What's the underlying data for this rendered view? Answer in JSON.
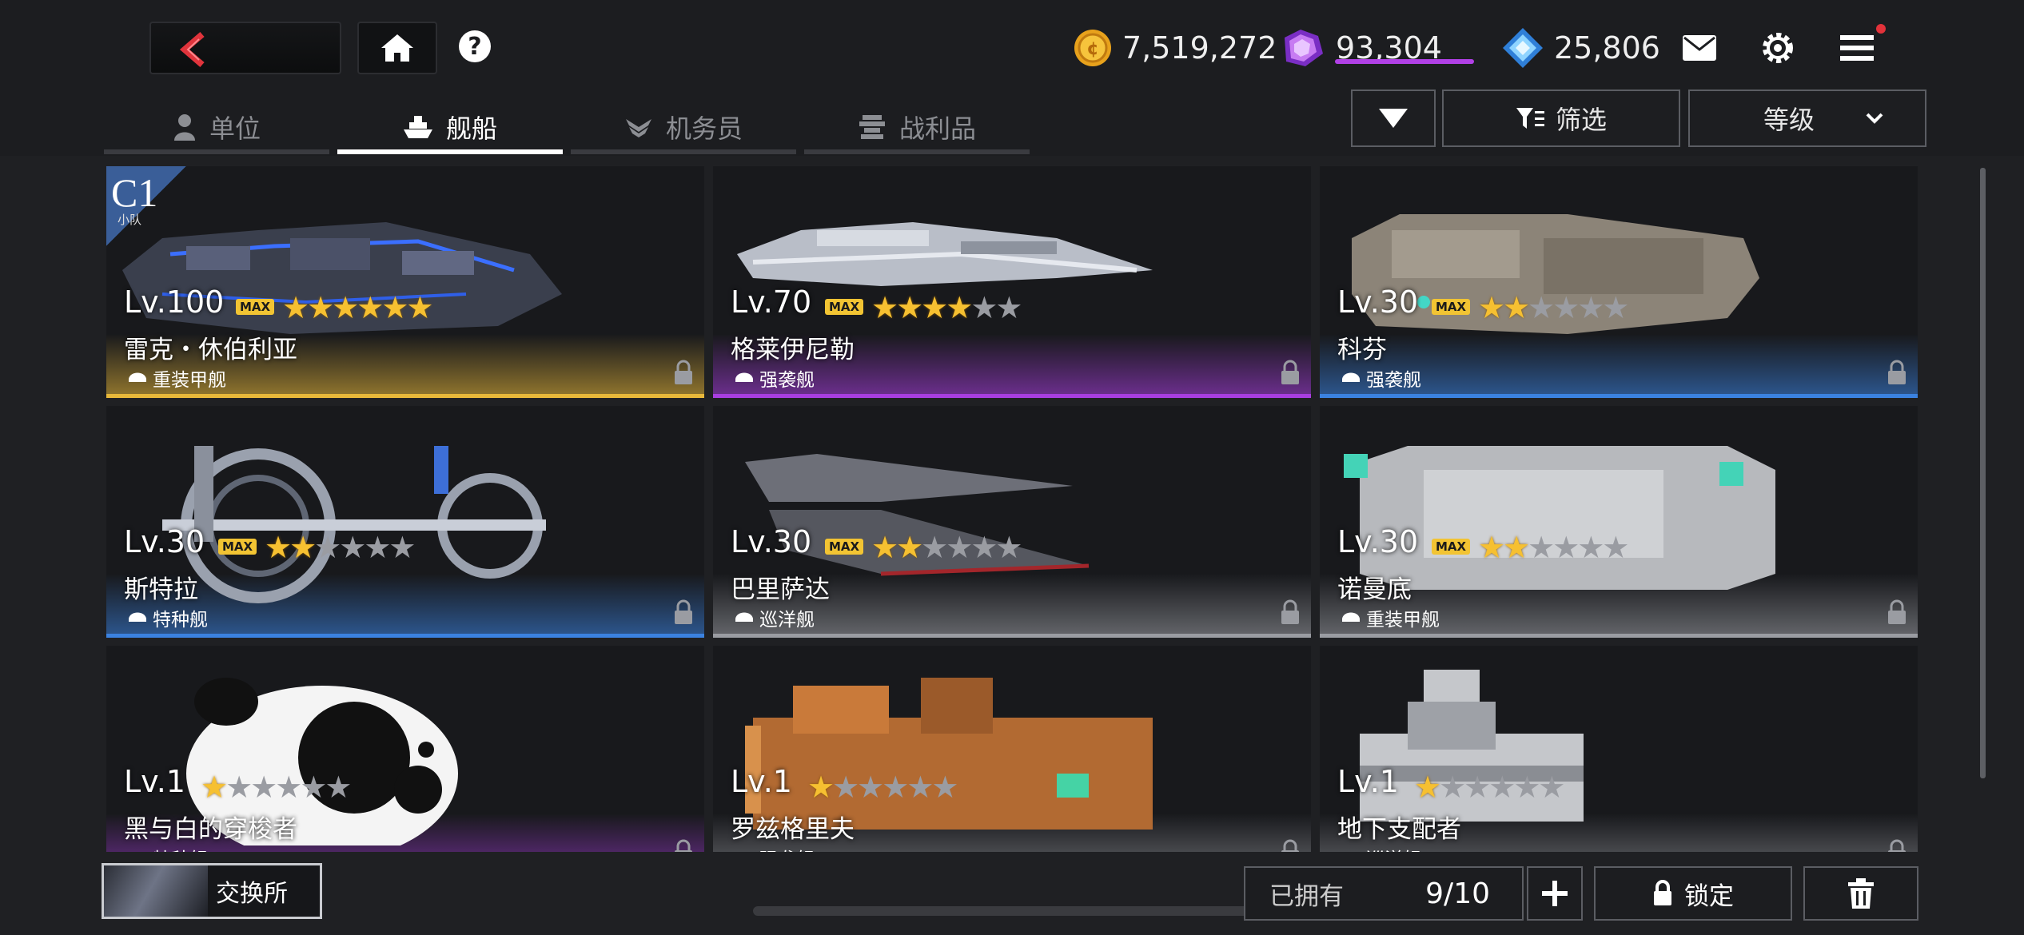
{
  "currencies": {
    "gold": "7,519,272",
    "gem": "93,304",
    "crystal": "25,806"
  },
  "tabs": [
    {
      "label": "单位",
      "icon": "pilot-icon",
      "active": false
    },
    {
      "label": "舰船",
      "icon": "ship-icon",
      "active": true
    },
    {
      "label": "机务员",
      "icon": "wing-icon",
      "active": false
    },
    {
      "label": "战利品",
      "icon": "trophy-icon",
      "active": false
    }
  ],
  "controls": {
    "filter_label": "筛选",
    "sort_label": "等级"
  },
  "ships": [
    {
      "level": "Lv.100",
      "max": "MAX",
      "stars": 6,
      "name": "雷克・休伯利亚",
      "type": "重装甲舰",
      "rarity_color": "#e8b83a",
      "badge": "C1",
      "badge_sub": "小队"
    },
    {
      "level": "Lv.70",
      "max": "MAX",
      "stars": 4,
      "name": "格莱伊尼勒",
      "type": "强袭舰",
      "rarity_color": "#a93ee0"
    },
    {
      "level": "Lv.30",
      "max": "MAX",
      "stars": 2,
      "name": "科芬",
      "type": "强袭舰",
      "rarity_color": "#3b82e0"
    },
    {
      "level": "Lv.30",
      "max": "MAX",
      "stars": 2,
      "name": "斯特拉",
      "type": "特种舰",
      "rarity_color": "#3b82e0"
    },
    {
      "level": "Lv.30",
      "max": "MAX",
      "stars": 2,
      "name": "巴里萨达",
      "type": "巡洋舰",
      "rarity_color": "#9a9ca2"
    },
    {
      "level": "Lv.30",
      "max": "MAX",
      "stars": 2,
      "name": "诺曼底",
      "type": "重装甲舰",
      "rarity_color": "#9a9ca2"
    },
    {
      "level": "Lv.1",
      "max": "",
      "stars": 1,
      "name": "黑与白的穿梭者",
      "type": "特种舰",
      "rarity_color": "#a93ee0"
    },
    {
      "level": "Lv.1",
      "max": "",
      "stars": 1,
      "name": "罗兹格里夫",
      "type": "强袭舰",
      "rarity_color": "#9a9ca2"
    },
    {
      "level": "Lv.1",
      "max": "",
      "stars": 1,
      "name": "地下支配者",
      "type": "巡洋舰",
      "rarity_color": "#9a9ca2"
    }
  ],
  "bottom": {
    "exchange_label": "交换所",
    "owned_label": "已拥有",
    "owned_count": "9/10",
    "lock_label": "锁定"
  }
}
